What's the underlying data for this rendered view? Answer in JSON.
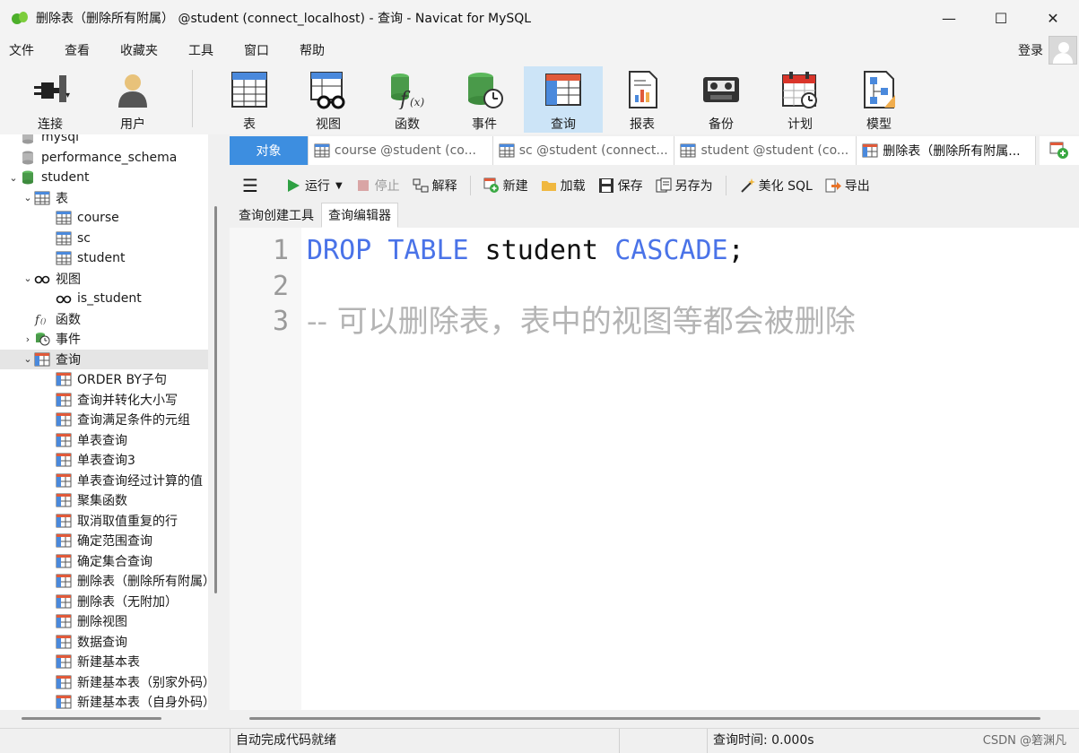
{
  "window": {
    "title": "删除表（删除所有附属） @student (connect_localhost) - 查询 - Navicat for MySQL",
    "controls": [
      "—",
      "☐",
      "✕"
    ]
  },
  "menu": {
    "items": [
      "文件",
      "查看",
      "收藏夹",
      "工具",
      "窗口",
      "帮助"
    ],
    "login": "登录"
  },
  "toolbar": {
    "tools": [
      {
        "label": "连接",
        "icon": "plug-icon"
      },
      {
        "label": "用户",
        "icon": "user-icon"
      },
      {
        "label": "表",
        "icon": "table-icon"
      },
      {
        "label": "视图",
        "icon": "view-icon"
      },
      {
        "label": "函数",
        "icon": "function-icon"
      },
      {
        "label": "事件",
        "icon": "event-icon"
      },
      {
        "label": "查询",
        "icon": "query-icon",
        "active": true
      },
      {
        "label": "报表",
        "icon": "report-icon"
      },
      {
        "label": "备份",
        "icon": "backup-icon"
      },
      {
        "label": "计划",
        "icon": "schedule-icon"
      },
      {
        "label": "模型",
        "icon": "model-icon"
      }
    ]
  },
  "tree": {
    "items": [
      {
        "label": "mysql",
        "level": 1,
        "icon": "database-icon"
      },
      {
        "label": "performance_schema",
        "level": 1,
        "icon": "database-icon"
      },
      {
        "label": "student",
        "level": 1,
        "icon": "database-green-icon",
        "expanded": true
      },
      {
        "label": "表",
        "level": 2,
        "icon": "table-icon",
        "expanded": true
      },
      {
        "label": "course",
        "level": 3,
        "icon": "table-icon"
      },
      {
        "label": "sc",
        "level": 3,
        "icon": "table-icon"
      },
      {
        "label": "student",
        "level": 3,
        "icon": "table-icon"
      },
      {
        "label": "视图",
        "level": 2,
        "icon": "view-icon",
        "expanded": true
      },
      {
        "label": "is_student",
        "level": 3,
        "icon": "view-icon"
      },
      {
        "label": "函数",
        "level": 2,
        "icon": "function-icon"
      },
      {
        "label": "事件",
        "level": 2,
        "icon": "event-icon",
        "collapsed": true
      },
      {
        "label": "查询",
        "level": 2,
        "icon": "query-icon",
        "expanded": true,
        "selected": true
      },
      {
        "label": "ORDER BY子句",
        "level": 3,
        "icon": "query-icon"
      },
      {
        "label": "查询并转化大小写",
        "level": 3,
        "icon": "query-icon"
      },
      {
        "label": "查询满足条件的元组",
        "level": 3,
        "icon": "query-icon"
      },
      {
        "label": "单表查询",
        "level": 3,
        "icon": "query-icon"
      },
      {
        "label": "单表查询3",
        "level": 3,
        "icon": "query-icon"
      },
      {
        "label": "单表查询经过计算的值",
        "level": 3,
        "icon": "query-icon"
      },
      {
        "label": "聚集函数",
        "level": 3,
        "icon": "query-icon"
      },
      {
        "label": "取消取值重复的行",
        "level": 3,
        "icon": "query-icon"
      },
      {
        "label": "确定范围查询",
        "level": 3,
        "icon": "query-icon"
      },
      {
        "label": "确定集合查询",
        "level": 3,
        "icon": "query-icon"
      },
      {
        "label": "删除表（删除所有附属）",
        "level": 3,
        "icon": "query-icon"
      },
      {
        "label": "删除表（无附加）",
        "level": 3,
        "icon": "query-icon"
      },
      {
        "label": "删除视图",
        "level": 3,
        "icon": "query-icon"
      },
      {
        "label": "数据查询",
        "level": 3,
        "icon": "query-icon"
      },
      {
        "label": "新建基本表",
        "level": 3,
        "icon": "query-icon"
      },
      {
        "label": "新建基本表（别家外码）",
        "level": 3,
        "icon": "query-icon"
      },
      {
        "label": "新建基本表（自身外码）",
        "level": 3,
        "icon": "query-icon"
      }
    ]
  },
  "tabs": {
    "object": "对象",
    "items": [
      {
        "label": "course @student (co...",
        "icon": "table-icon"
      },
      {
        "label": "sc @student (connect...",
        "icon": "table-icon"
      },
      {
        "label": "student @student (co...",
        "icon": "table-icon"
      },
      {
        "label": "删除表（删除所有附属...",
        "icon": "query-icon",
        "active": true
      }
    ]
  },
  "editor_toolbar": {
    "menu": "☰",
    "run": "运行",
    "stop": "停止",
    "explain": "解释",
    "new": "新建",
    "load": "加载",
    "save": "保存",
    "save_as": "另存为",
    "beautify": "美化 SQL",
    "export": "导出"
  },
  "subtabs": [
    "查询创建工具",
    "查询编辑器"
  ],
  "editor": {
    "lines": [
      {
        "no": "1",
        "tokens": [
          {
            "t": "DROP",
            "k": "kw"
          },
          {
            "t": " ",
            "k": "plain"
          },
          {
            "t": "TABLE",
            "k": "kw"
          },
          {
            "t": " student ",
            "k": "plain"
          },
          {
            "t": "CASCADE",
            "k": "kw"
          },
          {
            "t": ";",
            "k": "plain"
          }
        ]
      },
      {
        "no": "2",
        "tokens": []
      },
      {
        "no": "3",
        "tokens": [
          {
            "t": "-- 可以删除表，表中的视图等都会被删除",
            "k": "comment"
          }
        ]
      }
    ]
  },
  "status": {
    "message": "自动完成代码就绪",
    "query_time": "查询时间: 0.000s",
    "watermark": "CSDN @箬渊凡"
  },
  "colors": {
    "keyword": "#4a73e8",
    "comment": "#b4b4b4",
    "object_tab": "#3d8ee0",
    "active_tool": "#cce4f7"
  }
}
